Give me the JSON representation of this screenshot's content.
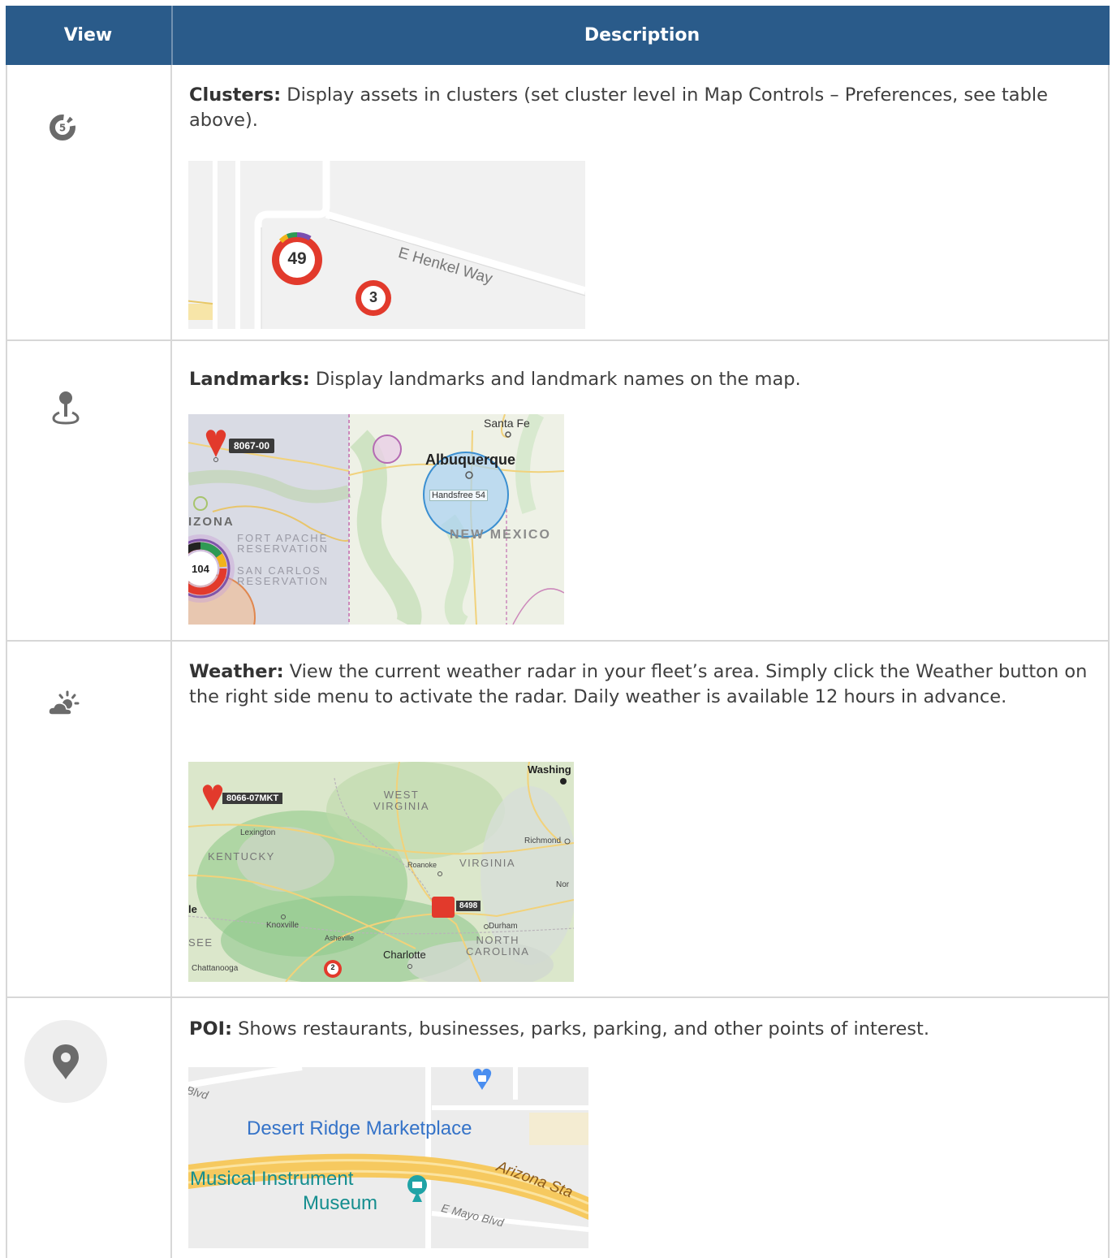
{
  "header": {
    "col_view": "View",
    "col_description": "Description"
  },
  "rows": [
    {
      "title": "Clusters:",
      "text": " Display assets in clusters (set cluster level in Map Controls – Preferences, see table above).",
      "icon": "cluster-icon",
      "icon_label": "5",
      "map": {
        "street": "E Henkel Way",
        "cluster_large": "49",
        "cluster_small": "3"
      }
    },
    {
      "title": "Landmarks:",
      "text": " Display landmarks and landmark names on the map.",
      "icon": "landmark-pin-icon",
      "map": {
        "santa_fe": "Santa Fe",
        "asset": "8067-00",
        "albuquerque": "Albuquerque",
        "landmark": "Handsfree 54",
        "arizona": "IZONA",
        "new_mexico": "NEW MEXICO",
        "fort_apache_1": "FORT APACHE",
        "fort_apache_2": "RESERVATION",
        "san_carlos_1": "SAN CARLOS",
        "san_carlos_2": "RESERVATION",
        "cluster": "104"
      }
    },
    {
      "title": "Weather:",
      "text": " View the current weather radar in your fleet’s area. Simply click the Weather button on the right side menu to activate the radar. Daily weather is available 12 hours in advance.",
      "icon": "partly-cloudy-icon",
      "map": {
        "washington": "Washing",
        "asset": "8066-07MKT",
        "west_1": "WEST",
        "west_2": "VIRGINIA",
        "lexington": "Lexington",
        "kentucky": "KENTUCKY",
        "richmond": "Richmond",
        "roanoke": "Roanoke",
        "virginia": "VIRGINIA",
        "nor": "Nor",
        "le": "le",
        "vehicle": "8498",
        "knoxville": "Knoxville",
        "durham": "Durham",
        "asheville": "Asheville",
        "north_1": "NORTH",
        "north_2": "CAROLINA",
        "see": "SEE",
        "charlotte": "Charlotte",
        "chattanooga": "Chattanooga",
        "cluster": "2"
      }
    },
    {
      "title": "POI:",
      "text": " Shows restaurants, businesses, parks, parking, and other points of interest.",
      "icon": "location-pin-icon",
      "map": {
        "blvd": "Blvd",
        "marketplace": "Desert Ridge Marketplace",
        "museum_1": "Musical Instrument",
        "museum_2": "Museum",
        "arizona": "Arizona Sta",
        "mayo": "E Mayo Blvd"
      }
    }
  ]
}
